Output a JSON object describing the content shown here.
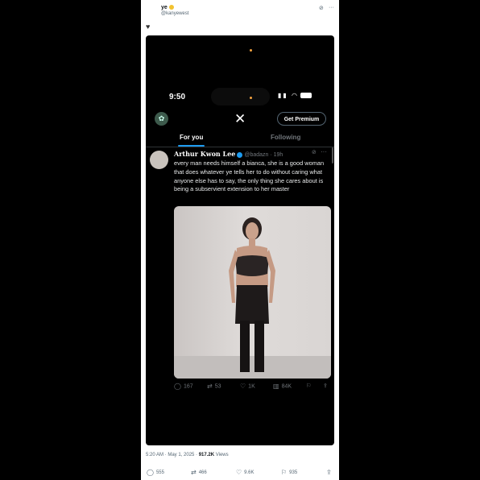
{
  "post": {
    "author_name": "ye",
    "author_handle": "@kanyewest",
    "body_icon": "black-heart-icon",
    "timestamp": "5:20 AM · May 1, 2025 · ",
    "views_count": "917.2K",
    "views_label": " Views",
    "actions": {
      "replies": "555",
      "reposts": "466",
      "likes": "9.6K",
      "bookmarks": "935"
    }
  },
  "screenshot": {
    "status_time": "9:50",
    "tabs": [
      "For you",
      "Following"
    ],
    "premium_label": "Get Premium",
    "tweet": {
      "author_name": "Arthur Kwon Lee",
      "handle_time": "@badazn · 19h",
      "text": "every man needs himself a bianca, she is a good woman that does whatever ye tells her to do without caring what anyone else has to say, the only thing she cares about is being a subservient extension to her master",
      "actions": {
        "replies": "167",
        "reposts": "53",
        "likes": "1K",
        "views": "84K"
      }
    }
  },
  "colors": {
    "accent": "#1d9bf0",
    "background": "#000000",
    "card": "#ffffff"
  }
}
